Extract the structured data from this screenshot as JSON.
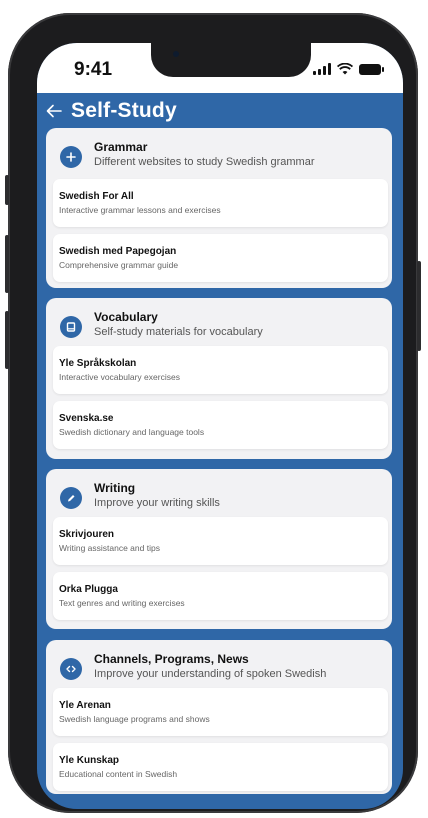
{
  "status": {
    "time": "9:41"
  },
  "header": {
    "title": "Self-Study"
  },
  "sections": [
    {
      "title": "Grammar",
      "description": "Different websites to study Swedish grammar",
      "icon": "plus-icon",
      "items": [
        {
          "title": "Swedish For All",
          "description": "Interactive grammar lessons and exercises"
        },
        {
          "title": "Swedish med Papegojan",
          "description": "Comprehensive grammar guide"
        }
      ]
    },
    {
      "title": "Vocabulary",
      "description": "Self-study materials for vocabulary",
      "icon": "book-icon",
      "items": [
        {
          "title": "Yle Språkskolan",
          "description": "Interactive vocabulary exercises"
        },
        {
          "title": "Svenska.se",
          "description": "Swedish dictionary and language tools"
        }
      ]
    },
    {
      "title": "Writing",
      "description": "Improve your writing skills",
      "icon": "pencil-icon",
      "items": [
        {
          "title": "Skrivjouren",
          "description": "Writing assistance and tips"
        },
        {
          "title": "Orka Plugga",
          "description": "Text genres and writing exercises"
        }
      ]
    },
    {
      "title": "Channels, Programs, News",
      "description": "Improve your understanding of spoken Swedish",
      "icon": "code-icon",
      "items": [
        {
          "title": "Yle Arenan",
          "description": "Swedish language programs and shows"
        },
        {
          "title": "Yle Kunskap",
          "description": "Educational content in Swedish"
        }
      ]
    }
  ],
  "colors": {
    "primary": "#2f67a7",
    "section_bg": "#f2f2f4",
    "card_bg": "#ffffff"
  }
}
